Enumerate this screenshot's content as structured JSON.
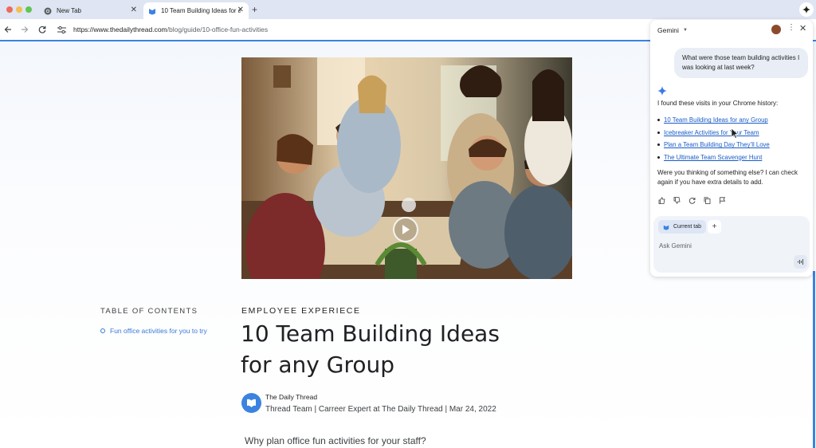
{
  "browser": {
    "tabs": [
      {
        "label": "New Tab",
        "icon": "chrome-icon",
        "active": false
      },
      {
        "label": "10 Team Building Ideas for a",
        "icon": "daily-thread-favicon",
        "active": true
      }
    ],
    "url_host": "https://www.thedailythread.com",
    "url_path": "/blog/guide/10-office-fun-activities"
  },
  "article": {
    "toc_title": "TABLE OF CONTENTS",
    "toc_items": [
      "Fun office activities for you to try"
    ],
    "eyebrow": "EMPLOYEE EXPERIECE",
    "title": "10 Team Building Ideas for any Group",
    "author_name": "The Daily Thread",
    "author_meta": "Thread Team | Carreer Expert at The Daily Thread | Mar 24, 2022",
    "subhead": "Why plan office fun activities for your staff?"
  },
  "gemini": {
    "title": "Gemini",
    "user_message": "What were those team building activities I was looking at last week?",
    "intro": "I found these visits in your Chrome history:",
    "links": [
      "10 Team Building Ideas for any Group",
      "Icebreaker Activities for Your Team",
      "Plan a Team Building Day They’ll Love",
      "The Ultimate Team Scavenger Hunt"
    ],
    "followup": "Were you thinking of something else? I can check again if you have extra details to add.",
    "chip_label": "Current tab",
    "input_placeholder": "Ask Gemini"
  },
  "colors": {
    "accent": "#3b82e0",
    "link": "#1a5cc7",
    "toc_link": "#3b7ad8"
  }
}
